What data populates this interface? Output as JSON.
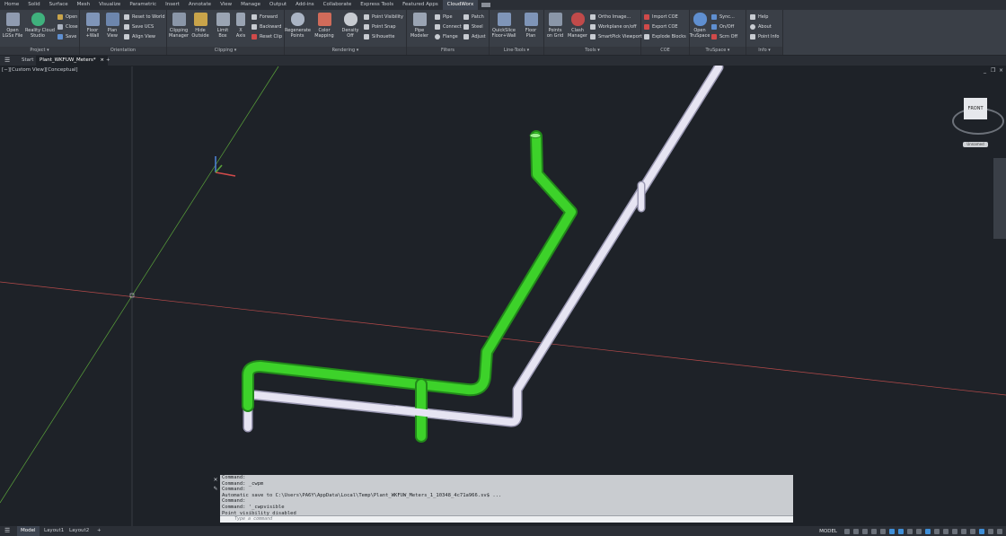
{
  "menubar": {
    "items": [
      "Home",
      "Solid",
      "Surface",
      "Mesh",
      "Visualize",
      "Parametric",
      "Insert",
      "Annotate",
      "View",
      "Manage",
      "Output",
      "Add-ins",
      "Collaborate",
      "Express Tools",
      "Featured Apps",
      "CloudWorx"
    ],
    "active": "CloudWorx"
  },
  "ribbon": {
    "panels": [
      {
        "title": "Project"
      },
      {
        "title": "Orientation"
      },
      {
        "title": "Clipping"
      },
      {
        "title": "Rendering"
      },
      {
        "title": "Filters"
      },
      {
        "title": "Line-Tools"
      },
      {
        "title": "Tools"
      },
      {
        "title": "COE"
      },
      {
        "title": "TruSpace"
      },
      {
        "title": "Info"
      }
    ],
    "project": {
      "open_lgs": "Open\nLGSx File",
      "reality_cloud": "Reality Cloud\nStudio",
      "open": "Open",
      "close": "Close",
      "save": "Save"
    },
    "orientation": {
      "floor_wall": "Floor\n+Wall",
      "plan_view": "Plan\nView",
      "reset_world": "Reset to World",
      "save_ucs": "Save UCS",
      "align_view": "Align View"
    },
    "clipping": {
      "clipping_manager": "Clipping\nManager",
      "hide_outside": "Hide\nOutside",
      "limit_box": "Limit\nBox",
      "x_axis": "X\nAxis",
      "forward": "Forward",
      "backward": "Backward",
      "reset_clip": "Reset Clip"
    },
    "rendering": {
      "regenerate_points": "Regenerate\nPoints",
      "color_mapping": "Color\nMapping",
      "density_off": "Density\nOff",
      "point_visibility": "Point Visibility",
      "point_snap": "Point Snap",
      "silhouette": "Silhouette"
    },
    "filters": {
      "pipe_modeler": "Pipe\nModeler",
      "pipe": "Pipe",
      "connect": "Connect",
      "flange": "Flange",
      "patch": "Patch",
      "steel": "Steel",
      "adjust": "Adjust"
    },
    "linetools": {
      "quickslice": "QuickSlice\nFloor+Wall",
      "floor_plan": "Floor\nPlan"
    },
    "tools": {
      "points_on_grid": "Points\non Grid",
      "clash_manager": "Clash\nManager",
      "ortho_image": "Ortho Image...",
      "workplane": "Workplane on/off",
      "smartpick": "SmartPick Viewport"
    },
    "coe": {
      "import_coe": "Import COE",
      "export_coe": "Export COE",
      "explode_blocks": "Explode Blocks"
    },
    "truspace": {
      "open_truspace": "Open\nTruSpace",
      "sync": "Sync...",
      "on_off": "On/Off",
      "scrn_off": "Scrn Off"
    },
    "info": {
      "help": "Help",
      "about": "About",
      "point_info": "Point Info"
    }
  },
  "tabs": {
    "start": "Start",
    "drawing": "Plant_WKFUW_Meters*",
    "close": "×",
    "add": "+"
  },
  "viewport": {
    "label": "[−][Custom View][Conceptual]",
    "viewcube_face": "FRONT",
    "viewcube_badge": "Unnamed",
    "win_min": "_",
    "win_restore": "❐",
    "win_close": "×"
  },
  "command": {
    "history": [
      "Command:",
      "Command: _cwpm",
      "Command:",
      "Automatic save to C:\\Users\\PA6Y\\AppData\\Local\\Temp\\Plant_WKFUW_Meters_1_10348_4c71a966.sv$ ...",
      "Command:",
      "Command: '_cwpvisible",
      "Point visibility disabled"
    ],
    "placeholder": "Type a command"
  },
  "statusbar": {
    "model_tab": "Model",
    "layout1": "Layout1",
    "layout2": "Layout2",
    "add": "+",
    "mode": "MODEL"
  },
  "colors": {
    "green_pipe": "#3dd22a",
    "white_pipe": "#e6e4f2",
    "axis_red": "#b54a4a",
    "axis_green": "#5aa33a"
  }
}
